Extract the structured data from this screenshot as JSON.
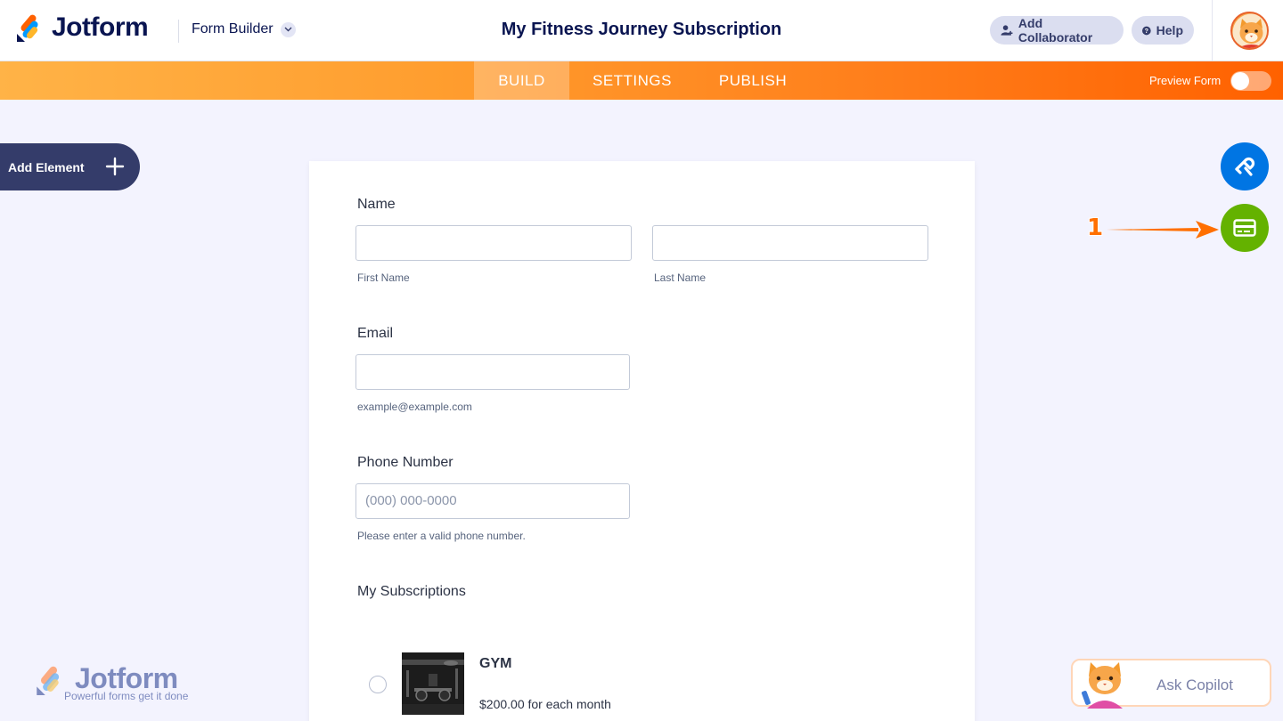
{
  "header": {
    "brand": "Jotform",
    "builder_label": "Form Builder",
    "form_title": "My Fitness Journey Subscription",
    "add_collaborator": "Add Collaborator",
    "help": "Help"
  },
  "nav": {
    "tabs": [
      {
        "label": "BUILD",
        "active": true
      },
      {
        "label": "SETTINGS",
        "active": false
      },
      {
        "label": "PUBLISH",
        "active": false
      }
    ],
    "preview_label": "Preview Form",
    "preview_on": false
  },
  "sidebar": {
    "add_element": "Add Element"
  },
  "form": {
    "name": {
      "label": "Name",
      "first_sublabel": "First Name",
      "last_sublabel": "Last Name",
      "first_value": "",
      "last_value": ""
    },
    "email": {
      "label": "Email",
      "value": "",
      "sublabel": "example@example.com"
    },
    "phone": {
      "label": "Phone Number",
      "placeholder": "(000) 000-0000",
      "sublabel": "Please enter a valid phone number."
    },
    "subscriptions": {
      "label": "My Subscriptions",
      "items": [
        {
          "name": "GYM",
          "price": "$200.00 for each month"
        }
      ]
    }
  },
  "annotation": {
    "number": "1"
  },
  "watermark": {
    "brand": "Jotform",
    "tagline": "Powerful forms get it done"
  },
  "copilot": {
    "label": "Ask Copilot"
  },
  "colors": {
    "brand_navy": "#0a1551",
    "nav_orange": "#ff7d1a",
    "fab_blue": "#0075e3",
    "fab_green": "#64b200",
    "annotation": "#ff6f00"
  }
}
